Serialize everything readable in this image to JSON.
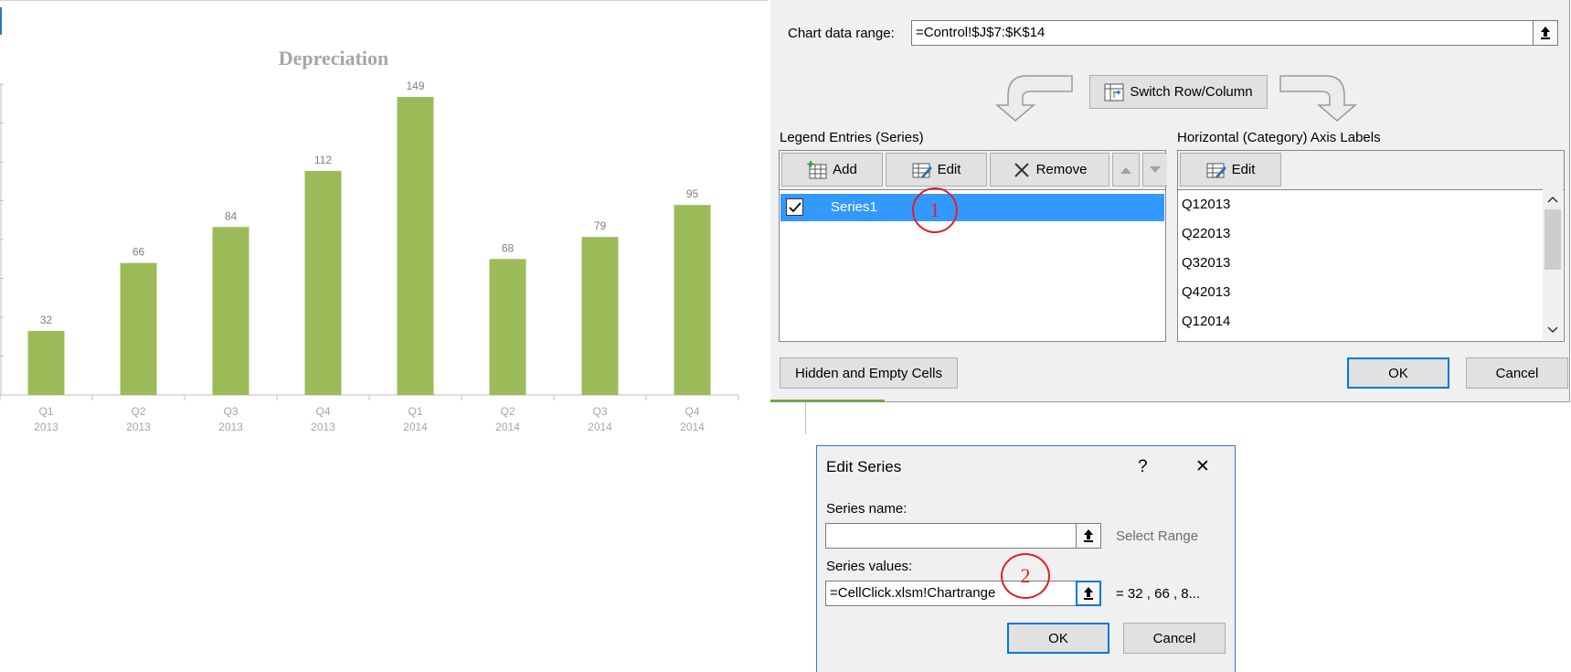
{
  "chart_data": {
    "type": "bar",
    "title": "Depreciation",
    "categories": [
      [
        "Q1",
        "2013"
      ],
      [
        "Q2",
        "2013"
      ],
      [
        "Q3",
        "2013"
      ],
      [
        "Q4",
        "2013"
      ],
      [
        "Q1",
        "2014"
      ],
      [
        "Q2",
        "2014"
      ],
      [
        "Q3",
        "2014"
      ],
      [
        "Q4",
        "2014"
      ]
    ],
    "values": [
      32,
      66,
      84,
      112,
      149,
      68,
      79,
      95
    ],
    "data_labels": [
      "32",
      "66",
      "84",
      "112",
      "149",
      "68",
      "79",
      "95"
    ],
    "ylim": [
      0,
      160
    ],
    "grid": false,
    "legend": "none",
    "colors": {
      "bar": "#9bbb59",
      "label": "#7f7f7f",
      "title": "#a6a6a6",
      "axis": "#bfbfbf"
    }
  },
  "select_data": {
    "range_label": "Chart data range:",
    "range_value": "=Control!$J$7:$K$14",
    "switch_label": "Switch Row/Column",
    "legend_header": "Legend Entries (Series)",
    "add_label": "Add",
    "edit_label": "Edit",
    "remove_label": "Remove",
    "series": [
      {
        "name": "Series1",
        "checked": true
      }
    ],
    "axis_header": "Horizontal (Category) Axis Labels",
    "axis_edit_label": "Edit",
    "axis_items": [
      "Q12013",
      "Q22013",
      "Q32013",
      "Q42013",
      "Q12014"
    ],
    "hidden_cells_label": "Hidden and Empty Cells",
    "ok_label": "OK",
    "cancel_label": "Cancel"
  },
  "annotations": {
    "marker1": "1",
    "marker2": "2"
  },
  "edit_series": {
    "title": "Edit Series",
    "help_glyph": "?",
    "close_glyph": "✕",
    "name_label": "Series name:",
    "name_value": "",
    "select_range_hint": "Select Range",
    "values_label": "Series values:",
    "values_value": "=CellClick.xlsm!Chartrange",
    "values_preview": "=  32 ,  66 ,  8...",
    "ok_label": "OK",
    "cancel_label": "Cancel"
  },
  "icons": {
    "collapse": "collapse-dialog-icon",
    "switch": "switch-row-column-icon",
    "add": "add-table-icon",
    "edit": "edit-table-icon",
    "remove": "remove-x-icon",
    "check": "checkmark-icon"
  }
}
